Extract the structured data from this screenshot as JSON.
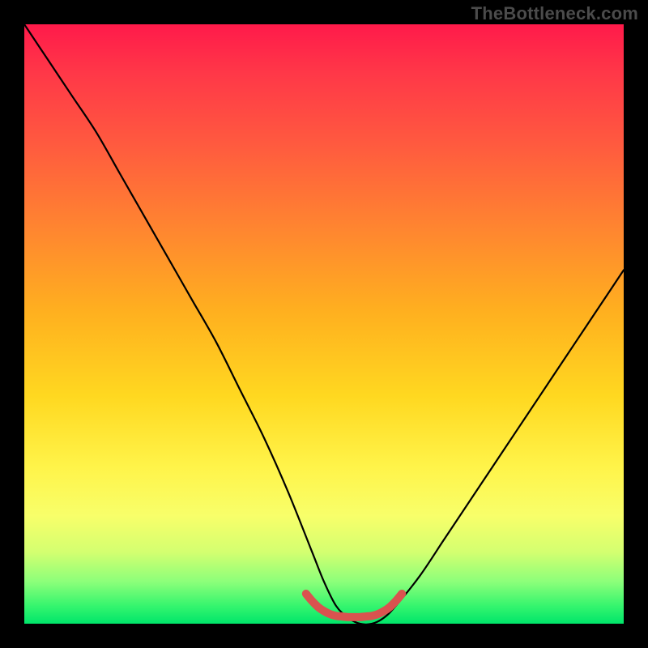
{
  "watermark": "TheBottleneck.com",
  "chart_data": {
    "type": "line",
    "title": "",
    "xlabel": "",
    "ylabel": "",
    "xlim": [
      0,
      100
    ],
    "ylim": [
      0,
      100
    ],
    "series": [
      {
        "name": "black-curve",
        "color": "#000000",
        "x": [
          0,
          4,
          8,
          12,
          16,
          20,
          24,
          28,
          32,
          36,
          40,
          44,
          48,
          50,
          52,
          54,
          56,
          58,
          60,
          62,
          66,
          70,
          74,
          78,
          82,
          86,
          90,
          94,
          98,
          100
        ],
        "values": [
          100,
          94,
          88,
          82,
          75,
          68,
          61,
          54,
          47,
          39,
          31,
          22,
          12,
          7,
          3,
          1,
          0,
          0,
          1,
          3,
          8,
          14,
          20,
          26,
          32,
          38,
          44,
          50,
          56,
          59
        ]
      },
      {
        "name": "red-bottom-band",
        "color": "#d9534f",
        "x": [
          47,
          48,
          49,
          50,
          51,
          52,
          53,
          54,
          55,
          56,
          57,
          58,
          59,
          60,
          61,
          62,
          63
        ],
        "values": [
          5,
          3.8,
          2.8,
          2.1,
          1.6,
          1.3,
          1.2,
          1.1,
          1.1,
          1.1,
          1.2,
          1.3,
          1.6,
          2.1,
          2.8,
          3.8,
          5
        ]
      }
    ],
    "gradient_stops": [
      {
        "pos": 0,
        "color": "#ff1a4a"
      },
      {
        "pos": 50,
        "color": "#ffd820"
      },
      {
        "pos": 100,
        "color": "#00e56a"
      }
    ]
  }
}
